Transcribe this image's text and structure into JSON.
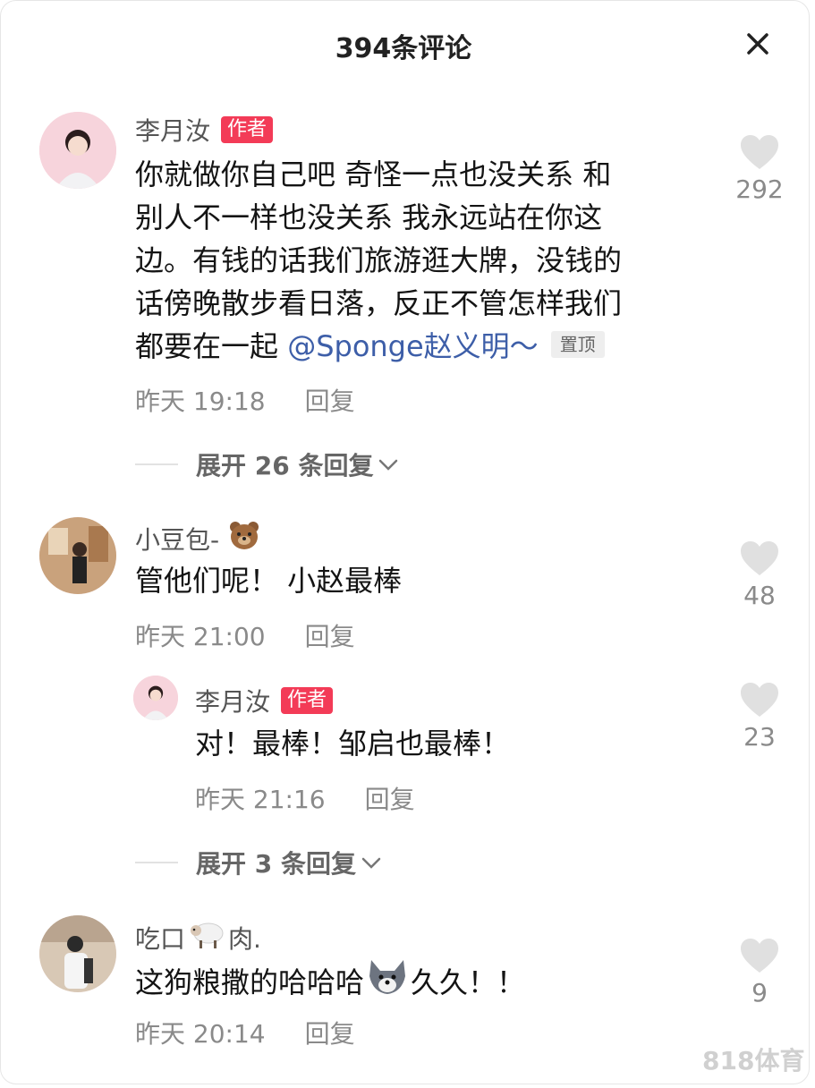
{
  "header": {
    "title": "394条评论"
  },
  "comments": [
    {
      "nickname": "李月汝",
      "badge": "作者",
      "lines": [
        "你就做你自己吧 奇怪一点也没关系 和",
        "别人不一样也没关系 我永远站在你这",
        "边。有钱的话我们旅游逛大牌，没钱的",
        "话傍晚散步看日落，反正不管怎样我们",
        "都要在一起 "
      ],
      "mention": "@Sponge赵义明～",
      "pin": "置顶",
      "time": "昨天 19:18",
      "reply_label": "回复",
      "likes": "292",
      "expand_label": "展开 26 条回复"
    },
    {
      "nickname": "小豆包-",
      "nickname_emoji": "bear-emoji",
      "text": "管他们呢！ 小赵最棒",
      "time": "昨天 21:00",
      "reply_label": "回复",
      "likes": "48",
      "sub_reply": {
        "nickname": "李月汝",
        "badge": "作者",
        "text": "对！最棒！邹启也最棒！",
        "time": "昨天 21:16",
        "reply_label": "回复",
        "likes": "23"
      },
      "expand_label": "展开 3 条回复"
    },
    {
      "nickname_prefix": "吃口",
      "nickname_emoji": "sheep-emoji",
      "nickname_suffix": "肉.",
      "text_prefix": "这狗粮撒的哈哈哈",
      "text_emoji": "wolf-emoji",
      "text_suffix": "久久！！",
      "time": "昨天 20:14",
      "reply_label": "回复",
      "likes": "9"
    }
  ],
  "watermark": "818体育",
  "colors": {
    "author_badge": "#f33b57",
    "mention": "#3d5ea8",
    "meta": "#8a8a8a"
  }
}
